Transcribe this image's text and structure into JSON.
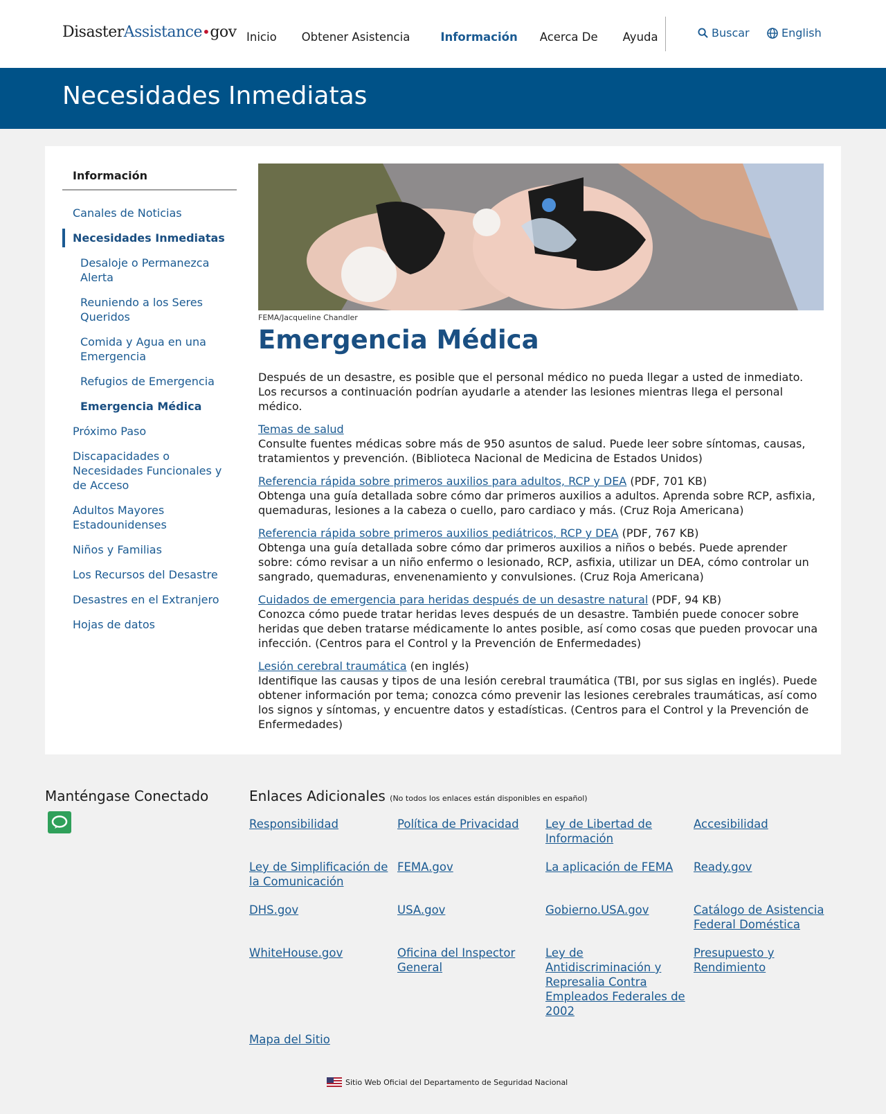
{
  "header": {
    "logo": {
      "part1": "Disaster",
      "part2": "Assistance",
      "dot": "•",
      "part3": "gov"
    },
    "nav": [
      "Inicio",
      "Obtener Asistencia",
      "Información",
      "Acerca De",
      "Ayuda"
    ],
    "search_label": "Buscar",
    "language_label": "English"
  },
  "banner": {
    "title": "Necesidades Inmediatas"
  },
  "sidebar": {
    "heading": "Información",
    "items": [
      "Canales de Noticias",
      "Necesidades Inmediatas",
      "Desaloje o Permanezca Alerta",
      "Reuniendo a los Seres Queridos",
      "Comida y Agua en una Emergencia",
      "Refugios de Emergencia",
      "Emergencia Médica",
      "Próximo Paso",
      "Discapacidades o Necesidades Funcionales y de Acceso",
      "Adultos Mayores Estadounidenses",
      "Niños y Familias",
      "Los Recursos del Desastre",
      "Desastres en el Extranjero",
      "Hojas de datos"
    ]
  },
  "main": {
    "photo_credit": "FEMA/Jacqueline Chandler",
    "title": "Emergencia Médica",
    "intro": "Después de un desastre, es posible que el personal médico no pueda llegar a usted de inmediato. Los recursos a continuación podrían ayudarle a atender las lesiones mientras llega el personal médico.",
    "resources": [
      {
        "link": "Temas de salud",
        "suffix": "",
        "desc": "Consulte fuentes médicas sobre más de 950 asuntos de salud. Puede leer sobre síntomas, causas, tratamientos y prevención. (Biblioteca Nacional de Medicina de Estados Unidos)"
      },
      {
        "link": "Referencia rápida sobre primeros auxilios para adultos, RCP y DEA",
        "suffix": " (PDF, 701 KB)",
        "desc": "Obtenga una guía detallada sobre cómo dar primeros auxilios a adultos. Aprenda sobre RCP, asfixia, quemaduras, lesiones a la cabeza o cuello, paro cardiaco y más. (Cruz Roja Americana)"
      },
      {
        "link": "Referencia rápida sobre primeros auxilios pediátricos, RCP y DEA",
        "suffix": " (PDF, 767 KB)",
        "desc": "Obtenga una guía detallada sobre cómo dar primeros auxilios a niños o bebés. Puede aprender sobre: cómo revisar a un niño enfermo o lesionado, RCP, asfixia, utilizar un DEA, cómo controlar un sangrado, quemaduras, envenenamiento y convulsiones. (Cruz Roja Americana)"
      },
      {
        "link": "Cuidados de emergencia para heridas después de un desastre natural",
        "suffix": " (PDF, 94 KB)",
        "desc": "Conozca cómo puede tratar heridas leves después de un desastre. También puede conocer sobre heridas que deben tratarse médicamente lo antes posible, así como cosas que pueden provocar una infección. (Centros para el Control y la Prevención de Enfermedades)"
      },
      {
        "link": "Lesión cerebral traumática",
        "suffix": " (en inglés)",
        "desc": "Identifique las causas y tipos de una lesión cerebral traumática (TBI, por sus siglas en inglés). Puede obtener información por tema; conozca cómo prevenir las lesiones cerebrales traumáticas, así como los signos y síntomas, y encuentre datos y estadísticas. (Centros para el Control y la Prevención de Enfermedades)"
      }
    ]
  },
  "footer": {
    "stay_connected": "Manténgase Conectado",
    "additional_links_title": "Enlaces Adicionales",
    "additional_links_note": "(No todos los enlaces están disponibles en español)",
    "links": [
      "Responsibilidad",
      "Política de Privacidad",
      "Ley de Libertad de Información",
      "Accesibilidad",
      "Ley de Simplificación de la Comunicación",
      "FEMA.gov",
      "La aplicación de FEMA",
      "Ready.gov",
      "DHS.gov",
      "USA.gov",
      "Gobierno.USA.gov",
      "Catálogo de Asistencia Federal Doméstica",
      "WhiteHouse.gov",
      "Oficina del Inspector General",
      "Ley de Antidiscriminación y Represalia Contra Empleados Federales de 2002",
      "Presupuesto y Rendimiento",
      "Mapa del Sitio"
    ],
    "official": "Sitio Web Oficial del Departamento de Seguridad Nacional"
  },
  "colors": {
    "primary": "#005288",
    "link": "#1a5a92",
    "chat": "#2fa05a"
  }
}
